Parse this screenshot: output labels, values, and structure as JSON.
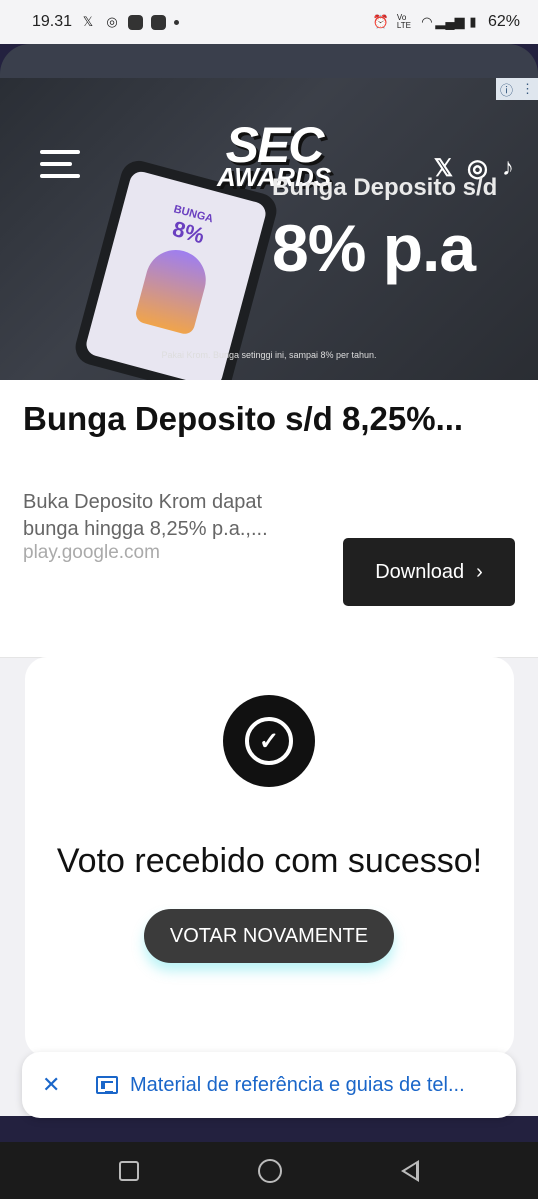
{
  "status_bar": {
    "time": "19.31",
    "battery": "62%"
  },
  "ad": {
    "banner": {
      "logo_line1": "SEC",
      "logo_line2": "AWARDS",
      "title": "Bunga Deposito s/d",
      "rate": "8% p.a",
      "phone_label": "BUNGA",
      "phone_rate": "8%",
      "footnote": "Pakai Krom. Bunga setinggi ini, sampai 8% per tahun."
    },
    "headline": "Bunga Deposito s/d 8,25%...",
    "description": "Buka Deposito Krom dapat bunga hingga 8,25% p.a.,...",
    "url": "play.google.com",
    "cta_label": "Download"
  },
  "vote_card": {
    "message": "Voto recebido com sucesso!",
    "button_label": "VOTAR NOVAMENTE"
  },
  "reference_bar": {
    "text": "Material de referência e guias de tel..."
  }
}
